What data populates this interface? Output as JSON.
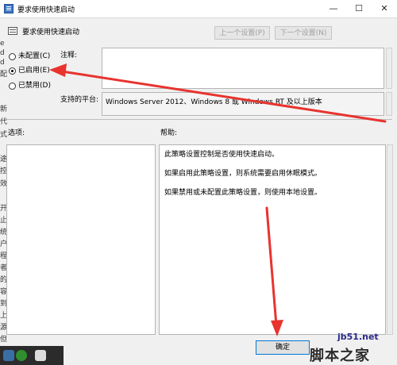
{
  "window": {
    "title": "要求使用快速启动"
  },
  "header": {
    "setting_name": "要求使用快速启动",
    "prev_label": "上一个设置(P)",
    "next_label": "下一个设置(N)"
  },
  "options": {
    "not_configured": "未配置(C)",
    "enabled": "已启用(E)",
    "disabled": "已禁用(D)"
  },
  "comment": {
    "label": "注释:",
    "value": ""
  },
  "platform": {
    "label": "支持的平台:",
    "value": "Windows Server 2012、Windows 8 或 Windows RT 及以上版本"
  },
  "sections": {
    "options_label": "选项:",
    "help_label": "帮助:"
  },
  "help": {
    "lines": [
      "此策略设置控制是否使用快速启动。",
      "如果启用此策略设置，则系统需要启用休眠模式。",
      "如果禁用或未配置此策略设置，则使用本地设置。"
    ]
  },
  "footer": {
    "ok_label": "确定"
  },
  "partial_left": [
    "e",
    "d",
    "d",
    "配",
    "新",
    "代",
    "式",
    "途",
    "控",
    "效",
    "开",
    "止",
    "统",
    "户",
    "程",
    "者",
    "的",
    "容",
    "到",
    "上",
    "源",
    "但"
  ],
  "watermark": {
    "site": "jb51.net",
    "brand": "脚本之家"
  },
  "colors": {
    "arrow": "#e8332e",
    "accent": "#0078d7"
  }
}
